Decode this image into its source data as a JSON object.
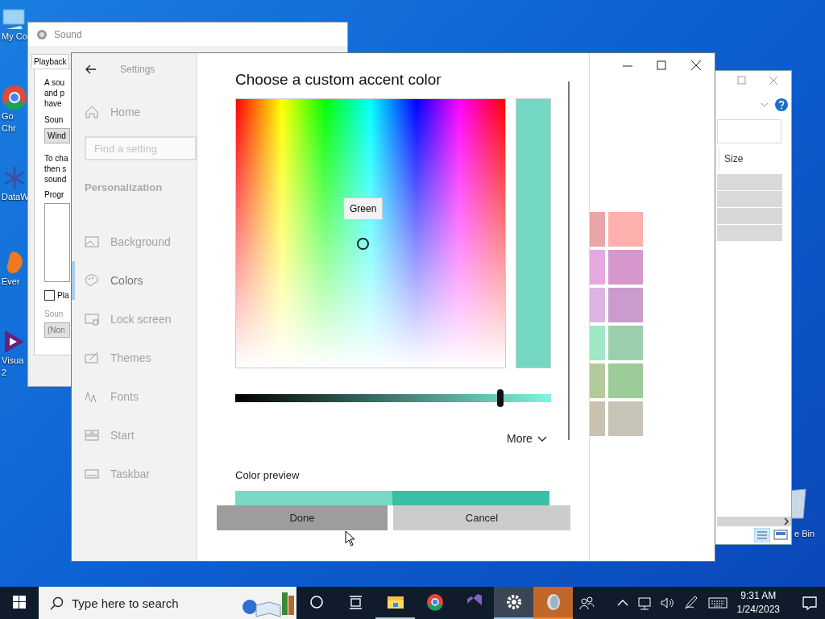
{
  "desktop_icons": [
    {
      "kind": "computer",
      "lines": [
        "My Co"
      ]
    },
    {
      "kind": "chrome",
      "lines": [
        "Go",
        "Chr"
      ]
    },
    {
      "kind": "snowflake",
      "lines": [
        "DataW"
      ]
    },
    {
      "kind": "blob",
      "lines": [
        "Ever"
      ]
    },
    {
      "kind": "vs",
      "lines": [
        "Visua",
        "2"
      ]
    }
  ],
  "recycle_bin": {
    "label": "e Bin"
  },
  "sound_window": {
    "title": "Sound",
    "tab": "Playback",
    "intro": [
      "A sou",
      "and p",
      "have"
    ],
    "scheme_label": "Soun",
    "scheme_value": "Wind",
    "help": [
      "To cha",
      "then s",
      "sound"
    ],
    "events_label": "Progr",
    "checkbox": {
      "label": "Pla",
      "checked": false
    },
    "sounds_label": "Soun",
    "sounds_value": "(Non"
  },
  "explorer_window": {
    "column": "Size",
    "rows": [
      {
        "selected": true
      },
      {
        "selected": true
      },
      {
        "selected": true
      },
      {
        "selected": true
      }
    ]
  },
  "settings_window": {
    "title": "Settings",
    "home": "Home",
    "search_placeholder": "Find a setting",
    "section": "Personalization",
    "nav": [
      {
        "label": "Background",
        "selected": false
      },
      {
        "label": "Colors",
        "selected": true
      },
      {
        "label": "Lock screen",
        "selected": false
      },
      {
        "label": "Themes",
        "selected": false
      },
      {
        "label": "Fonts",
        "selected": false
      },
      {
        "label": "Start",
        "selected": false
      },
      {
        "label": "Taskbar",
        "selected": false
      }
    ],
    "swatches": [
      {
        "color": "#e8a6a8"
      },
      {
        "color": "#fdb0ad"
      },
      {
        "color": "#e6a8e0"
      },
      {
        "color": "#d597cc"
      },
      {
        "color": "#dcb5e6"
      },
      {
        "color": "#c99ccd"
      },
      {
        "color": "#9ee8c7"
      },
      {
        "color": "#9ccfae"
      },
      {
        "color": "#b3ca9a"
      },
      {
        "color": "#9ccc98"
      },
      {
        "color": "#c8c2b0"
      },
      {
        "color": "#c7c3b7"
      }
    ]
  },
  "dialog": {
    "title": "Choose a custom accent color",
    "tooltip": "Green",
    "slider": {
      "level": 0.84
    },
    "more": "More",
    "preview_label": "Color preview",
    "buttons": [
      {
        "label": "Done",
        "kind": "primary"
      },
      {
        "label": "Cancel",
        "kind": "secondary"
      }
    ]
  },
  "taskbar": {
    "search_placeholder": "Type here to search",
    "apps": [
      {
        "kind": "explorer",
        "selected": false,
        "running": true,
        "flashing": false
      },
      {
        "kind": "chrome",
        "selected": false,
        "running": false,
        "flashing": false
      },
      {
        "kind": "vs",
        "selected": false,
        "running": false,
        "flashing": false
      },
      {
        "kind": "settings",
        "selected": true,
        "running": true,
        "flashing": false
      },
      {
        "kind": "sound",
        "selected": false,
        "running": true,
        "flashing": true
      }
    ],
    "time": "9:31 AM",
    "date": "1/24/2023"
  }
}
